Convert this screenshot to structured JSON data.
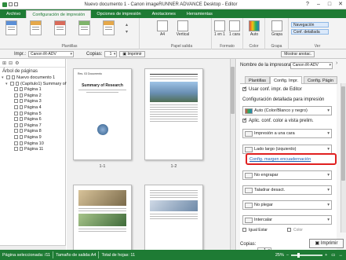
{
  "app": {
    "title": "Nuevo documento 1 - Canon imageRUNNER ADVANCE Desktop - Editor",
    "window_controls": {
      "min": "–",
      "max": "□",
      "close": "✕",
      "help": "?"
    }
  },
  "menu": {
    "tabs": [
      "Archivo",
      "Configuración de impresión",
      "Opciones de impresión",
      "Anotaciones",
      "Herramientas"
    ],
    "active_index": 1
  },
  "ribbon": {
    "groups": {
      "templates_label": "Plantillas",
      "paper_label": "Papel salida",
      "format_label": "Formato",
      "color_label": "Color",
      "staple_label": "Grapa",
      "view_label": "Ver"
    },
    "paper_size": "A4",
    "orientation": "Vertical",
    "layout_a": "1 en 1",
    "layout_b": "1 cara",
    "color": "Auto",
    "staple": "Grapa",
    "view_buttons": [
      "Navegación",
      "Conf. detallada"
    ]
  },
  "toolbar": {
    "printer_label": "Impr.:",
    "printer_value": "Canon iR-ADV",
    "copies_label": "Copias:",
    "copies_value": "1",
    "print_button": "Imprimir",
    "show_annotations": "Mostrar anotac."
  },
  "left_panel": {
    "heading": "Árbol de páginas",
    "tree": [
      {
        "label": "Nuevo documento 1",
        "level": 0,
        "exp": "▾"
      },
      {
        "label": "(Capítulo1) Summary of R",
        "level": 1,
        "exp": "▾"
      },
      {
        "label": "Página 1",
        "level": 2
      },
      {
        "label": "Página 2",
        "level": 2
      },
      {
        "label": "Página 3",
        "level": 2
      },
      {
        "label": "Página 4",
        "level": 2
      },
      {
        "label": "Página 5",
        "level": 2
      },
      {
        "label": "Página 6",
        "level": 2
      },
      {
        "label": "Página 7",
        "level": 2
      },
      {
        "label": "Página 8",
        "level": 2
      },
      {
        "label": "Página 9",
        "level": 2
      },
      {
        "label": "Página 10",
        "level": 2
      },
      {
        "label": "Página 11",
        "level": 2
      }
    ]
  },
  "preview": {
    "pages": [
      {
        "label": "1-1",
        "heading": "Summary of Research"
      },
      {
        "label": "1-2",
        "heading": ""
      },
      {
        "label": "",
        "heading": ""
      },
      {
        "label": "",
        "heading": ""
      }
    ],
    "page1_small": "Res. 03 Documento"
  },
  "right_panel": {
    "printer_label": "Nombre de la impresora:",
    "printer_value": "Canon iR-ADV",
    "tabs": [
      "Plantillas",
      "Config. Impr.",
      "Config. Págin"
    ],
    "active_tab": 1,
    "use_editor_settings": "Usar conf. impr. de Editor",
    "detailed_heading": "Configuración detallada para impresión",
    "color_mode": "Auto (Color/Blanco y negro)",
    "apply_preview": "Aplic. conf. color a vista prelim.",
    "sides": "Impresión a una cara",
    "binding": "Lado largo (izquierdo)",
    "binding_link": "Config. margen encuadernación",
    "fold": "No engrapar",
    "punch": "Taladrar desact.",
    "no_fold": "No plegar",
    "collate": "Intercalar",
    "equal_label": "Igual Estar",
    "color_label": "Color",
    "copies_label": "Copias:",
    "copies_value": "1",
    "print_button": "Imprimir"
  },
  "status": {
    "selected": "Página seleccionada: /11",
    "paper_size": "Tamaño de salida:A4",
    "total": "Total de hojas: 11",
    "zoom": "25%"
  },
  "colors": {
    "accent": "#1e7b34",
    "link": "#1a5fb4",
    "highlight": "#e02020"
  }
}
